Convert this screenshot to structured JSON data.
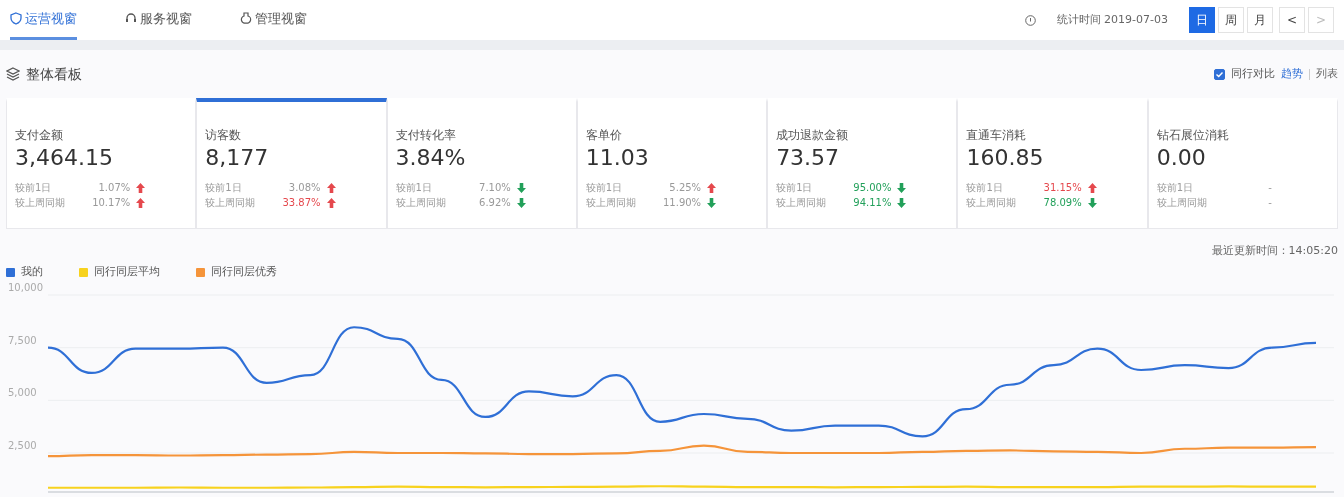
{
  "tabs": [
    {
      "label": "运营视窗",
      "kind": "shield",
      "selected": true
    },
    {
      "label": "服务视窗",
      "kind": "headset",
      "selected": false
    },
    {
      "label": "管理视窗",
      "kind": "bulb",
      "selected": false
    }
  ],
  "toolbar": {
    "stat_time": "统计时间 2019-07-03",
    "periods": [
      {
        "label": "日",
        "selected": true
      },
      {
        "label": "周",
        "selected": false
      },
      {
        "label": "月",
        "selected": false
      }
    ],
    "prev": "<",
    "next": ">"
  },
  "board": {
    "title": "整体看板",
    "compare": {
      "label": "同行对比",
      "checked": true
    },
    "views": [
      {
        "label": "趋势",
        "selected": true
      },
      {
        "label": "列表",
        "selected": false
      }
    ]
  },
  "metrics": [
    {
      "label": "支付金额",
      "value": "3,464.15",
      "selected": false,
      "rows": [
        {
          "label": "较前1日",
          "change": "1.07%",
          "kind": "up",
          "color": "#999999"
        },
        {
          "label": "较上周同期",
          "change": "10.17%",
          "kind": "up",
          "color": "#999999"
        }
      ]
    },
    {
      "label": "访客数",
      "value": "8,177",
      "selected": true,
      "rows": [
        {
          "label": "较前1日",
          "change": "3.08%",
          "kind": "up",
          "color": "#999999"
        },
        {
          "label": "较上周同期",
          "change": "33.87%",
          "kind": "up",
          "color": "#e5484d"
        }
      ]
    },
    {
      "label": "支付转化率",
      "value": "3.84%",
      "selected": false,
      "rows": [
        {
          "label": "较前1日",
          "change": "7.10%",
          "kind": "down",
          "color": "#999999"
        },
        {
          "label": "较上周同期",
          "change": "6.92%",
          "kind": "down",
          "color": "#999999"
        }
      ]
    },
    {
      "label": "客单价",
      "value": "11.03",
      "selected": false,
      "rows": [
        {
          "label": "较前1日",
          "change": "5.25%",
          "kind": "up",
          "color": "#999999"
        },
        {
          "label": "较上周同期",
          "change": "11.90%",
          "kind": "down",
          "color": "#999999"
        }
      ]
    },
    {
      "label": "成功退款金额",
      "value": "73.57",
      "selected": false,
      "rows": [
        {
          "label": "较前1日",
          "change": "95.00%",
          "kind": "down",
          "color": "#22a05a"
        },
        {
          "label": "较上周同期",
          "change": "94.11%",
          "kind": "down",
          "color": "#22a05a"
        }
      ]
    },
    {
      "label": "直通车消耗",
      "value": "160.85",
      "selected": false,
      "rows": [
        {
          "label": "较前1日",
          "change": "31.15%",
          "kind": "up",
          "color": "#e5484d"
        },
        {
          "label": "较上周同期",
          "change": "78.09%",
          "kind": "down",
          "color": "#22a05a"
        }
      ]
    },
    {
      "label": "钻石展位消耗",
      "value": "0.00",
      "selected": false,
      "rows": [
        {
          "label": "较前1日",
          "change": "-",
          "kind": "none"
        },
        {
          "label": "较上周同期",
          "change": "-",
          "kind": "none"
        }
      ]
    }
  ],
  "chart": {
    "updated": "最近更新时间：14:05:20",
    "chart_data": {
      "type": "line",
      "grid": true,
      "ylim": [
        600,
        10000
      ],
      "yticks": [
        {
          "value": 2500,
          "label": "2,500"
        },
        {
          "value": 5000,
          "label": "5,000"
        },
        {
          "value": 7500,
          "label": "7,500"
        },
        {
          "value": 10000,
          "label": "10,000"
        }
      ],
      "series": [
        {
          "name": "我的",
          "color": "#2f6fd6",
          "values": [
            7500,
            6300,
            7450,
            7450,
            7500,
            5830,
            6200,
            8470,
            7920,
            5970,
            4210,
            5420,
            5190,
            6200,
            3980,
            4350,
            4120,
            3560,
            3800,
            3800,
            3290,
            4580,
            5740,
            6670,
            7450,
            6440,
            6670,
            6530,
            7500,
            7730
          ]
        },
        {
          "name": "同行同层平均",
          "color": "#f7d21e",
          "values": [
            850,
            850,
            850,
            860,
            850,
            850,
            860,
            880,
            900,
            880,
            870,
            880,
            890,
            900,
            920,
            900,
            880,
            880,
            870,
            880,
            890,
            900,
            880,
            880,
            880,
            900,
            900,
            910,
            900,
            900
          ]
        },
        {
          "name": "同行同层优秀",
          "color": "#f5943a",
          "values": [
            2350,
            2400,
            2400,
            2380,
            2400,
            2420,
            2450,
            2550,
            2500,
            2500,
            2480,
            2450,
            2450,
            2480,
            2600,
            2850,
            2550,
            2500,
            2500,
            2500,
            2550,
            2600,
            2620,
            2580,
            2550,
            2500,
            2700,
            2750,
            2750,
            2780
          ]
        }
      ]
    }
  }
}
